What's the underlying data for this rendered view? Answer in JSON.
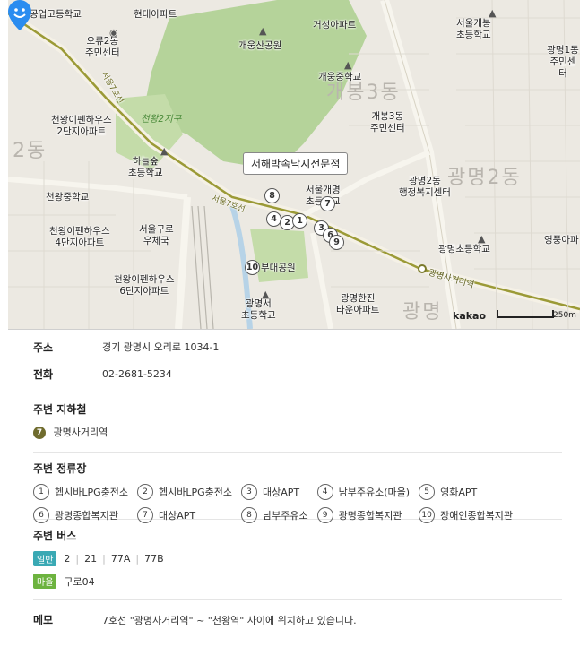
{
  "map": {
    "place_bubble": "서해박속낙지전문점",
    "watermark": "kakao",
    "scale": "250m",
    "labels": [
      {
        "text": "공업고등학교"
      },
      {
        "text": "현대아파트"
      },
      {
        "text": "오류2동\n주민센터"
      },
      {
        "text": "개웅산공원"
      },
      {
        "text": "거성아파트"
      },
      {
        "text": "서울개봉\n초등학교"
      },
      {
        "text": "광명1동\n주민센터"
      },
      {
        "text": "개웅중학교"
      },
      {
        "text": "천왕이펜하우스\n2단지아파트"
      },
      {
        "text": "개봉3동\n주민센터"
      },
      {
        "text": "하늘숲\n초등학교"
      },
      {
        "text": "광명2동\n행정복지센터"
      },
      {
        "text": "천왕중학교"
      },
      {
        "text": "서울개명\n초등학교"
      },
      {
        "text": "천왕이펜하우스\n4단지아파트"
      },
      {
        "text": "서울구로\n우체국"
      },
      {
        "text": "광명초등학교"
      },
      {
        "text": "영풍아파"
      },
      {
        "text": "부대공원"
      },
      {
        "text": "천왕이펜하우스\n6단지아파트"
      },
      {
        "text": "광명서\n초등학교"
      },
      {
        "text": "광명한진\n타운아파트"
      },
      {
        "text": "서울7호선"
      },
      {
        "text": "광명사거리역"
      },
      {
        "text": "서울7호선"
      }
    ],
    "green_label": "천왕2지구",
    "big_areas": [
      "2동",
      "개봉3동",
      "광명2동",
      "광명"
    ],
    "stops": [
      "1",
      "2",
      "3",
      "4",
      "5",
      "6",
      "7",
      "8",
      "9",
      "10"
    ]
  },
  "info": {
    "address_label": "주소",
    "address": "경기 광명시 오리로 1034-1",
    "phone_label": "전화",
    "phone": "02-2681-5234",
    "subway_title": "주변 지하철",
    "subway": {
      "line": "7",
      "line_color": "#6f6b2d",
      "station": "광명사거리역"
    },
    "busstop_title": "주변 정류장",
    "busstops": [
      {
        "num": "1",
        "name": "헵시바LPG충전소"
      },
      {
        "num": "2",
        "name": "헵시바LPG충전소"
      },
      {
        "num": "3",
        "name": "대상APT"
      },
      {
        "num": "4",
        "name": "남부주유소(마을)"
      },
      {
        "num": "5",
        "name": "영화APT"
      },
      {
        "num": "6",
        "name": "광명종합복지관"
      },
      {
        "num": "7",
        "name": "대상APT"
      },
      {
        "num": "8",
        "name": "남부주유소"
      },
      {
        "num": "9",
        "name": "광명종합복지관"
      },
      {
        "num": "10",
        "name": "장애인종합복지관"
      }
    ],
    "bus_title": "주변 버스",
    "bus_general_badge": "일반",
    "bus_general": [
      "2",
      "21",
      "77A",
      "77B"
    ],
    "bus_village_badge": "마을",
    "bus_village": [
      "구로04"
    ],
    "memo_label": "메모",
    "memo": "7호선 \"광명사거리역\" ~ \"천왕역\" 사이에 위치하고 있습니다."
  }
}
